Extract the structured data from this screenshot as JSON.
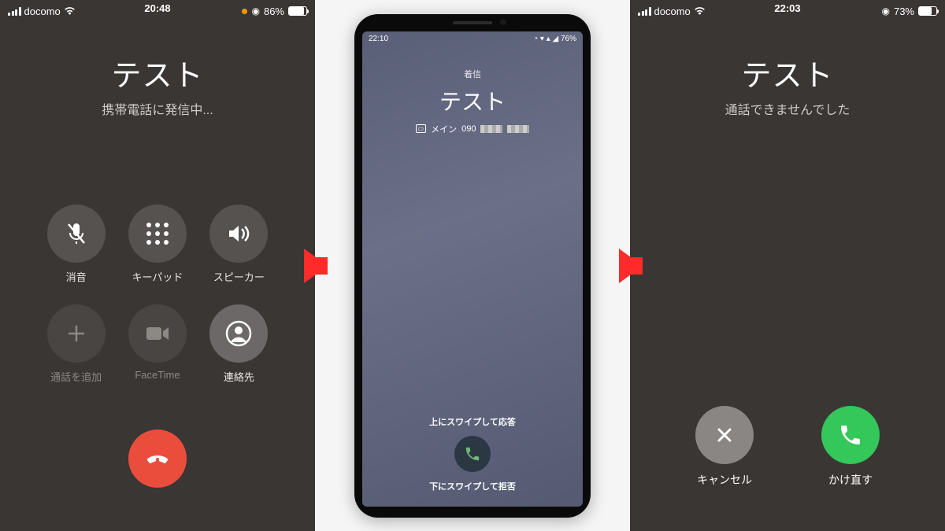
{
  "panel1": {
    "status": {
      "carrier": "docomo",
      "time": "20:48",
      "battery_pct": "86%",
      "battery_fill": 86
    },
    "caller_name": "テスト",
    "caller_sub": "携帯電話に発信中...",
    "buttons": {
      "mute": "消音",
      "keypad": "キーパッド",
      "speaker": "スピーカー",
      "add": "通話を追加",
      "facetime": "FaceTime",
      "contacts": "連絡先"
    }
  },
  "panel2": {
    "status_time": "22:10",
    "status_batt": "76%",
    "incoming_label": "着信",
    "caller_name": "テスト",
    "sim_label": "メイン",
    "number_prefix": "090",
    "swipe_up": "上にスワイプして応答",
    "swipe_down": "下にスワイプして拒否"
  },
  "panel3": {
    "status": {
      "carrier": "docomo",
      "time": "22:03",
      "battery_pct": "73%",
      "battery_fill": 73
    },
    "caller_name": "テスト",
    "caller_sub": "通話できませんでした",
    "cancel": "キャンセル",
    "callback": "かけ直す"
  }
}
